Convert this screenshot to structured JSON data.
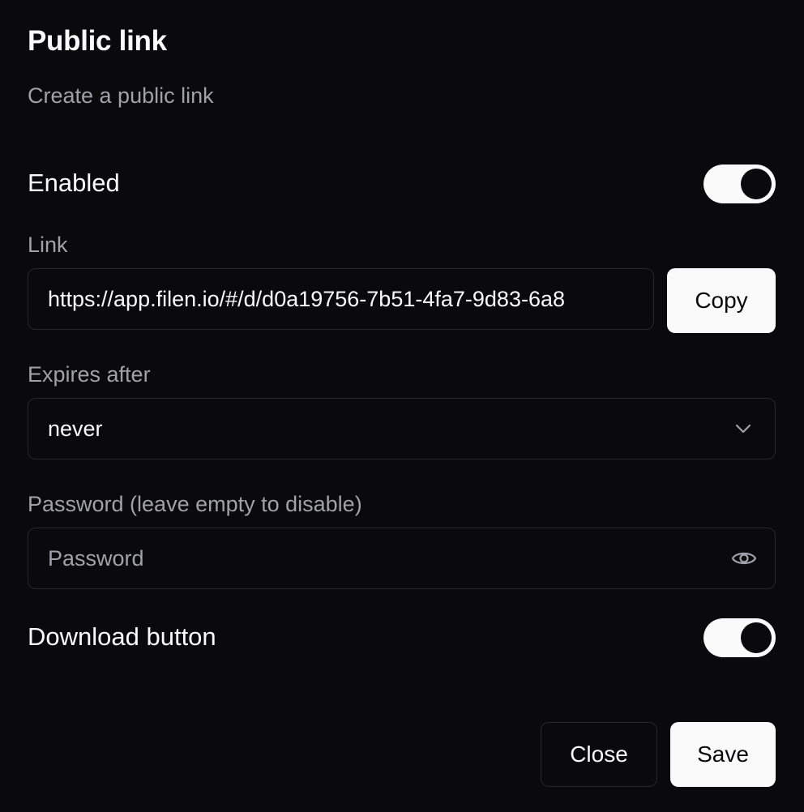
{
  "dialog": {
    "title": "Public link",
    "subtitle": "Create a public link"
  },
  "enabled": {
    "label": "Enabled",
    "on": true
  },
  "link": {
    "label": "Link",
    "value": "https://app.filen.io/#/d/d0a19756-7b51-4fa7-9d83-6a8",
    "copy_label": "Copy"
  },
  "expires": {
    "label": "Expires after",
    "selected": "never",
    "icon": "chevron-down-icon"
  },
  "password": {
    "label": "Password (leave empty to disable)",
    "placeholder": "Password",
    "value": "",
    "icon": "eye-icon"
  },
  "download_button": {
    "label": "Download button",
    "on": true
  },
  "footer": {
    "close_label": "Close",
    "save_label": "Save"
  },
  "colors": {
    "background": "#0a0a0c",
    "foreground": "#fafafa",
    "muted": "#a1a1aa",
    "border": "#27272a"
  }
}
